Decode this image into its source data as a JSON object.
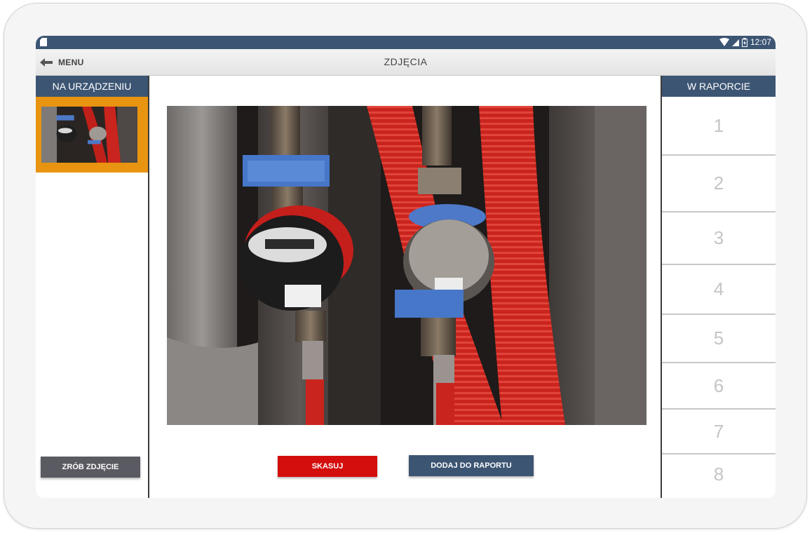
{
  "status_bar": {
    "time": "12:07"
  },
  "app_bar": {
    "menu_label": "MENU",
    "title": "ZDJĘCIA"
  },
  "left_panel": {
    "title": "NA URZĄDZENIU",
    "take_photo_label": "ZRÓB ZDJĘCIE"
  },
  "center": {
    "delete_label": "SKASUJ",
    "add_label": "DODAJ DO RAPORTU"
  },
  "right_panel": {
    "title": "W RAPORCIE",
    "slots": [
      "1",
      "2",
      "3",
      "4",
      "5",
      "6",
      "7",
      "8"
    ]
  },
  "colors": {
    "brand": "#3c5573",
    "selection": "#e89411",
    "delete": "#d40d0d",
    "take_photo": "#5a5a62"
  }
}
